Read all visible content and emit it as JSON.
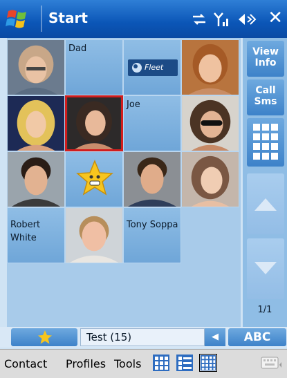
{
  "titlebar": {
    "title": "Start",
    "close": "✕"
  },
  "grid": {
    "cells": [
      {
        "id": "c1",
        "label": "",
        "kind": "photo"
      },
      {
        "id": "c2",
        "label": "Dad",
        "kind": "text"
      },
      {
        "id": "c3",
        "label": "Fleet",
        "kind": "logo"
      },
      {
        "id": "c4",
        "label": "",
        "kind": "photo"
      },
      {
        "id": "c5",
        "label": "",
        "kind": "photo"
      },
      {
        "id": "c6",
        "label": "",
        "kind": "photo",
        "selected": true
      },
      {
        "id": "c7",
        "label": "Joe",
        "kind": "text"
      },
      {
        "id": "c8",
        "label": "",
        "kind": "photo"
      },
      {
        "id": "c9",
        "label": "",
        "kind": "photo"
      },
      {
        "id": "c10",
        "label": "",
        "kind": "star"
      },
      {
        "id": "c11",
        "label": "",
        "kind": "photo"
      },
      {
        "id": "c12",
        "label": "",
        "kind": "photo"
      },
      {
        "id": "c13",
        "label": "Robert White",
        "kind": "text"
      },
      {
        "id": "c14",
        "label": "",
        "kind": "photo"
      },
      {
        "id": "c15",
        "label": "Tony Soppa",
        "kind": "text"
      }
    ]
  },
  "side": {
    "view_info": "View Info",
    "call_sms": "Call Sms",
    "page": "1/1"
  },
  "filter": {
    "text": "Test (15)",
    "abc": "ABC",
    "arrow": "◀"
  },
  "menu": {
    "contact": "Contact",
    "profiles": "Profiles",
    "tools": "Tools"
  }
}
